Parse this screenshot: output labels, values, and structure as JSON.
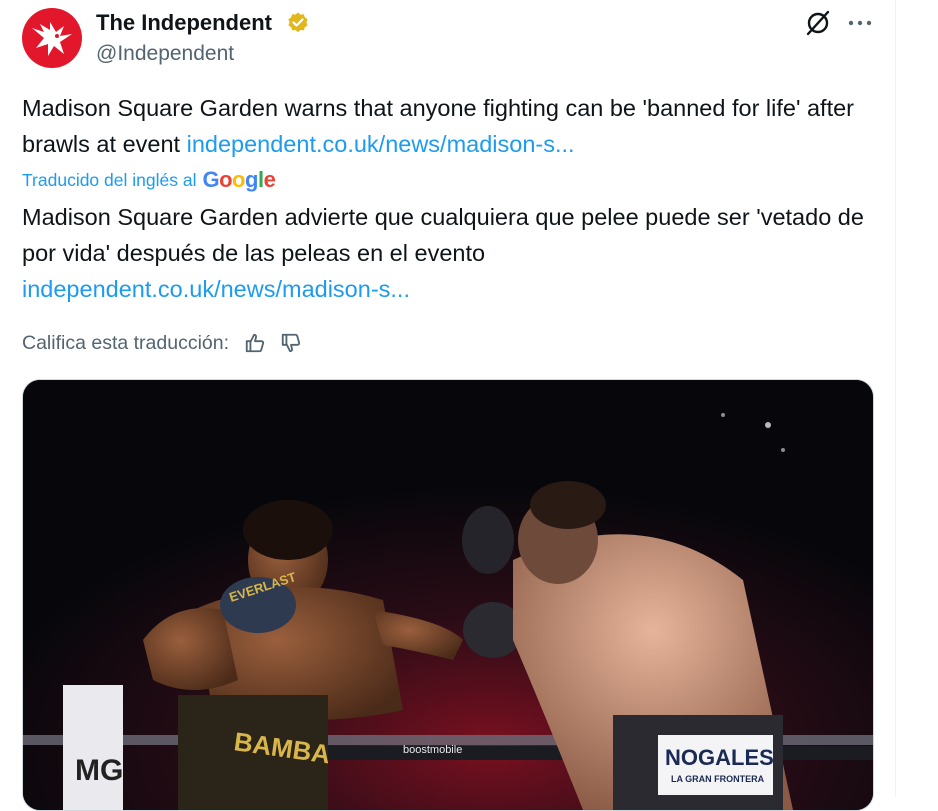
{
  "author": {
    "name": "The Independent",
    "handle": "@Independent",
    "verified_color": "#e2b719"
  },
  "actions": {
    "grok_icon": "grok-icon",
    "more_icon": "more-icon"
  },
  "tweet": {
    "text": "Madison Square Garden warns that anyone fighting can be 'banned for life' after brawls at event ",
    "link": "independent.co.uk/news/madison-s..."
  },
  "translation": {
    "label": "Traducido del inglés al",
    "provider": "Google",
    "text": "Madison Square Garden advierte que cualquiera que pelee puede ser 'vetado de por vida' después de las peleas en el evento",
    "link": "independent.co.uk/news/madison-s...",
    "rate_label": "Califica esta traducción:"
  },
  "media": {
    "trunks_left": "BAMBA",
    "glove_left": "EVERLAST",
    "trunks_right": "NOGALES",
    "trunks_right_sub": "LA GRAN FRONTERA",
    "ring_sponsor": "boostmobile",
    "banner_letters": "MG"
  },
  "colors": {
    "link": "#1d9bf0",
    "secondary_text": "#536471",
    "brand_red": "#e3172b"
  }
}
